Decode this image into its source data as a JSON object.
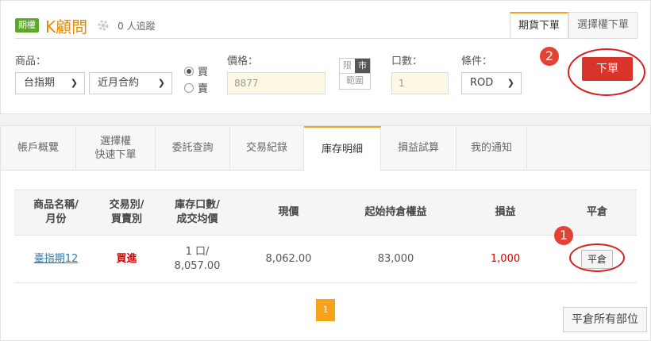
{
  "header": {
    "badge": "期權",
    "title": "K顧問",
    "followers": "0 人追蹤",
    "tabs": [
      "期貨下單",
      "選擇權下單"
    ]
  },
  "order_form": {
    "product_label": "商品：",
    "product_value": "台指期",
    "contract_value": "近月合約",
    "side_buy": "買",
    "side_sell": "賣",
    "price_label": "價格：",
    "price_placeholder": "8877",
    "limit_label": "限",
    "market_label": "市",
    "range_label": "範圍",
    "qty_label": "口數：",
    "qty_placeholder": "1",
    "cond_label": "條件：",
    "cond_value": "ROD",
    "submit_label": "下單"
  },
  "steps": {
    "one": "1",
    "two": "2"
  },
  "tabs": [
    "帳戶概覽",
    "選擇權\n快速下單",
    "委託查詢",
    "交易紀錄",
    "庫存明細",
    "損益試算",
    "我的通知"
  ],
  "table": {
    "headers": {
      "name": "商品名稱/\n月份",
      "side": "交易別/\n買賣別",
      "qty": "庫存口數/\n成交均價",
      "price": "現價",
      "equity": "起始持倉權益",
      "pnl": "損益",
      "close": "平倉"
    },
    "rows": [
      {
        "name": "臺指期12",
        "side": "買進",
        "qty": "1 口/\n8,057.00",
        "price": "8,062.00",
        "equity": "83,000",
        "pnl": "1,000",
        "close": "平倉"
      }
    ]
  },
  "pagination": {
    "current": "1"
  },
  "close_all_label": "平倉所有部位",
  "colors": {
    "accent": "#f7a21b",
    "danger": "#d9342b",
    "buy": "#d80000",
    "brand": "#e68a00"
  }
}
